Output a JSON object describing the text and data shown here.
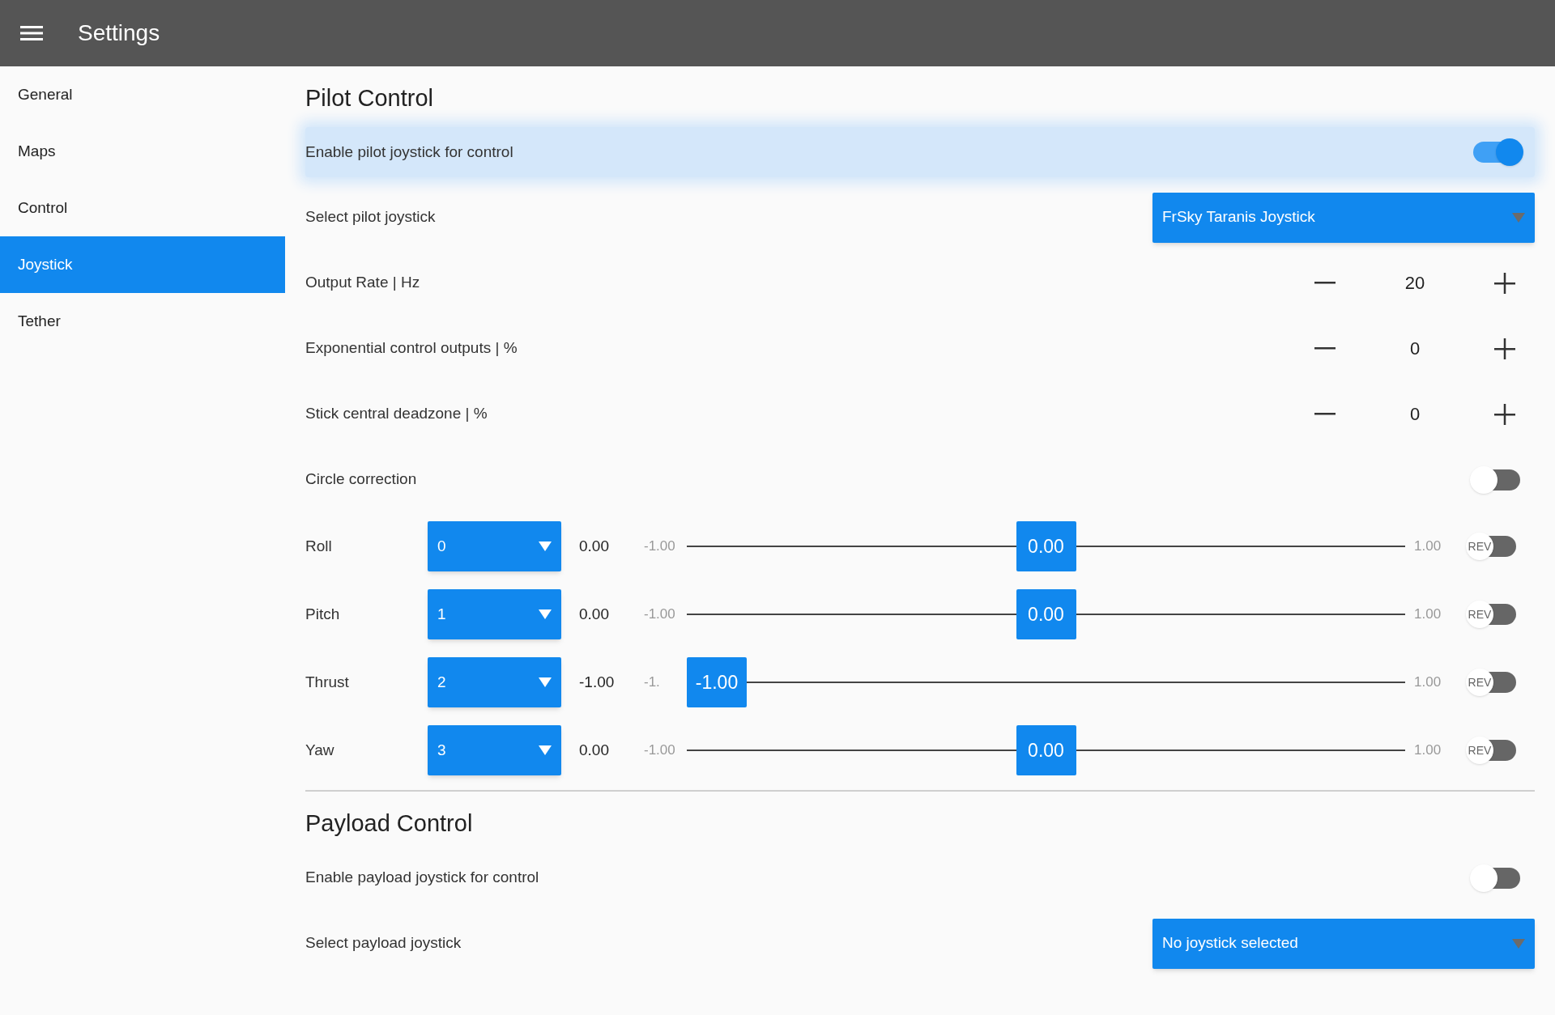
{
  "app_bar": {
    "title": "Settings"
  },
  "sidebar": {
    "items": [
      {
        "label": "General",
        "selected": false
      },
      {
        "label": "Maps",
        "selected": false
      },
      {
        "label": "Control",
        "selected": false
      },
      {
        "label": "Joystick",
        "selected": true
      },
      {
        "label": "Tether",
        "selected": false
      }
    ]
  },
  "pilot_control": {
    "heading": "Pilot Control",
    "rows": [
      {
        "kind": "toggle",
        "label": "Enable pilot joystick for control",
        "on": true,
        "highlighted": true
      },
      {
        "kind": "select",
        "label": "Select pilot joystick",
        "value": "FrSky Taranis Joystick"
      },
      {
        "kind": "stepper",
        "label": "Output Rate | Hz",
        "value": "20"
      },
      {
        "kind": "stepper",
        "label": "Exponential control outputs | %",
        "value": "0"
      },
      {
        "kind": "stepper",
        "label": "Stick central deadzone | %",
        "value": "0"
      },
      {
        "kind": "toggle",
        "label": "Circle correction",
        "on": false,
        "highlighted": false
      }
    ],
    "axes": [
      {
        "name": "Roll",
        "channel": "0",
        "value": "0.00",
        "min_label": "-1.00",
        "max_label": "1.00",
        "handle_value": "0.00",
        "level": 0.5,
        "reversed": false,
        "rev_label": "REV"
      },
      {
        "name": "Pitch",
        "channel": "1",
        "value": "0.00",
        "min_label": "-1.00",
        "max_label": "1.00",
        "handle_value": "0.00",
        "level": 0.5,
        "reversed": false,
        "rev_label": "REV"
      },
      {
        "name": "Thrust",
        "channel": "2",
        "value": "-1.00",
        "min_label": "-1.",
        "max_label": "1.00",
        "handle_value": "-1.00",
        "level": 0,
        "reversed": false,
        "rev_label": "REV"
      },
      {
        "name": "Yaw",
        "channel": "3",
        "value": "0.00",
        "min_label": "-1.00",
        "max_label": "1.00",
        "handle_value": "0.00",
        "level": 0.5,
        "reversed": false,
        "rev_label": "REV"
      }
    ]
  },
  "payload_control": {
    "heading": "Payload Control",
    "rows": [
      {
        "kind": "toggle",
        "label": "Enable payload joystick for control",
        "on": false,
        "highlighted": false
      },
      {
        "kind": "select",
        "label": "Select payload joystick",
        "value": "No joystick selected"
      }
    ]
  }
}
